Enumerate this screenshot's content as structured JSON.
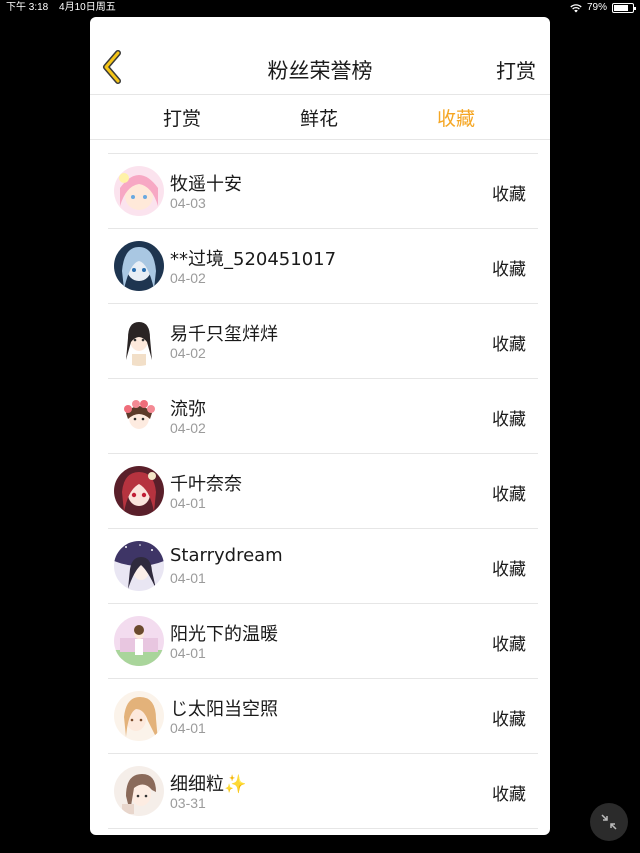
{
  "status_bar": {
    "time": "下午 3:18",
    "date": "4月10日周五",
    "battery": "79%",
    "battery_level": 0.79,
    "wifi_icon": "wifi-icon",
    "battery_icon": "battery-icon"
  },
  "header": {
    "back_icon": "chevron-left-icon",
    "title": "粉丝荣誉榜",
    "action": "打赏"
  },
  "colors": {
    "accent": "#f5a623",
    "back_icon": "#f5c518"
  },
  "tabs": [
    {
      "label": "打赏",
      "active": false
    },
    {
      "label": "鲜花",
      "active": false
    },
    {
      "label": "收藏",
      "active": true
    }
  ],
  "fans": [
    {
      "name": "牧遥十安",
      "date": "04-03",
      "action": "收藏",
      "avatar": "avatar-pink-hair"
    },
    {
      "name": "**过境_520451017",
      "date": "04-02",
      "action": "收藏",
      "avatar": "avatar-blue-hair"
    },
    {
      "name": "易千只玺烊烊",
      "date": "04-02",
      "action": "收藏",
      "avatar": "avatar-dark-hair"
    },
    {
      "name": "流弥",
      "date": "04-02",
      "action": "收藏",
      "avatar": "avatar-flower-crown"
    },
    {
      "name": "千叶奈奈",
      "date": "04-01",
      "action": "收藏",
      "avatar": "avatar-red-hair"
    },
    {
      "name": "Starrydream",
      "date": "04-01",
      "action": "收藏",
      "avatar": "avatar-night-sky"
    },
    {
      "name": "阳光下的温暖",
      "date": "04-01",
      "action": "收藏",
      "avatar": "avatar-field"
    },
    {
      "name": "じ太阳当空照",
      "date": "04-01",
      "action": "收藏",
      "avatar": "avatar-blonde"
    },
    {
      "name": "细细粒✨",
      "date": "03-31",
      "action": "收藏",
      "avatar": "avatar-brown-hair"
    }
  ],
  "fab_icon": "collapse-icon"
}
